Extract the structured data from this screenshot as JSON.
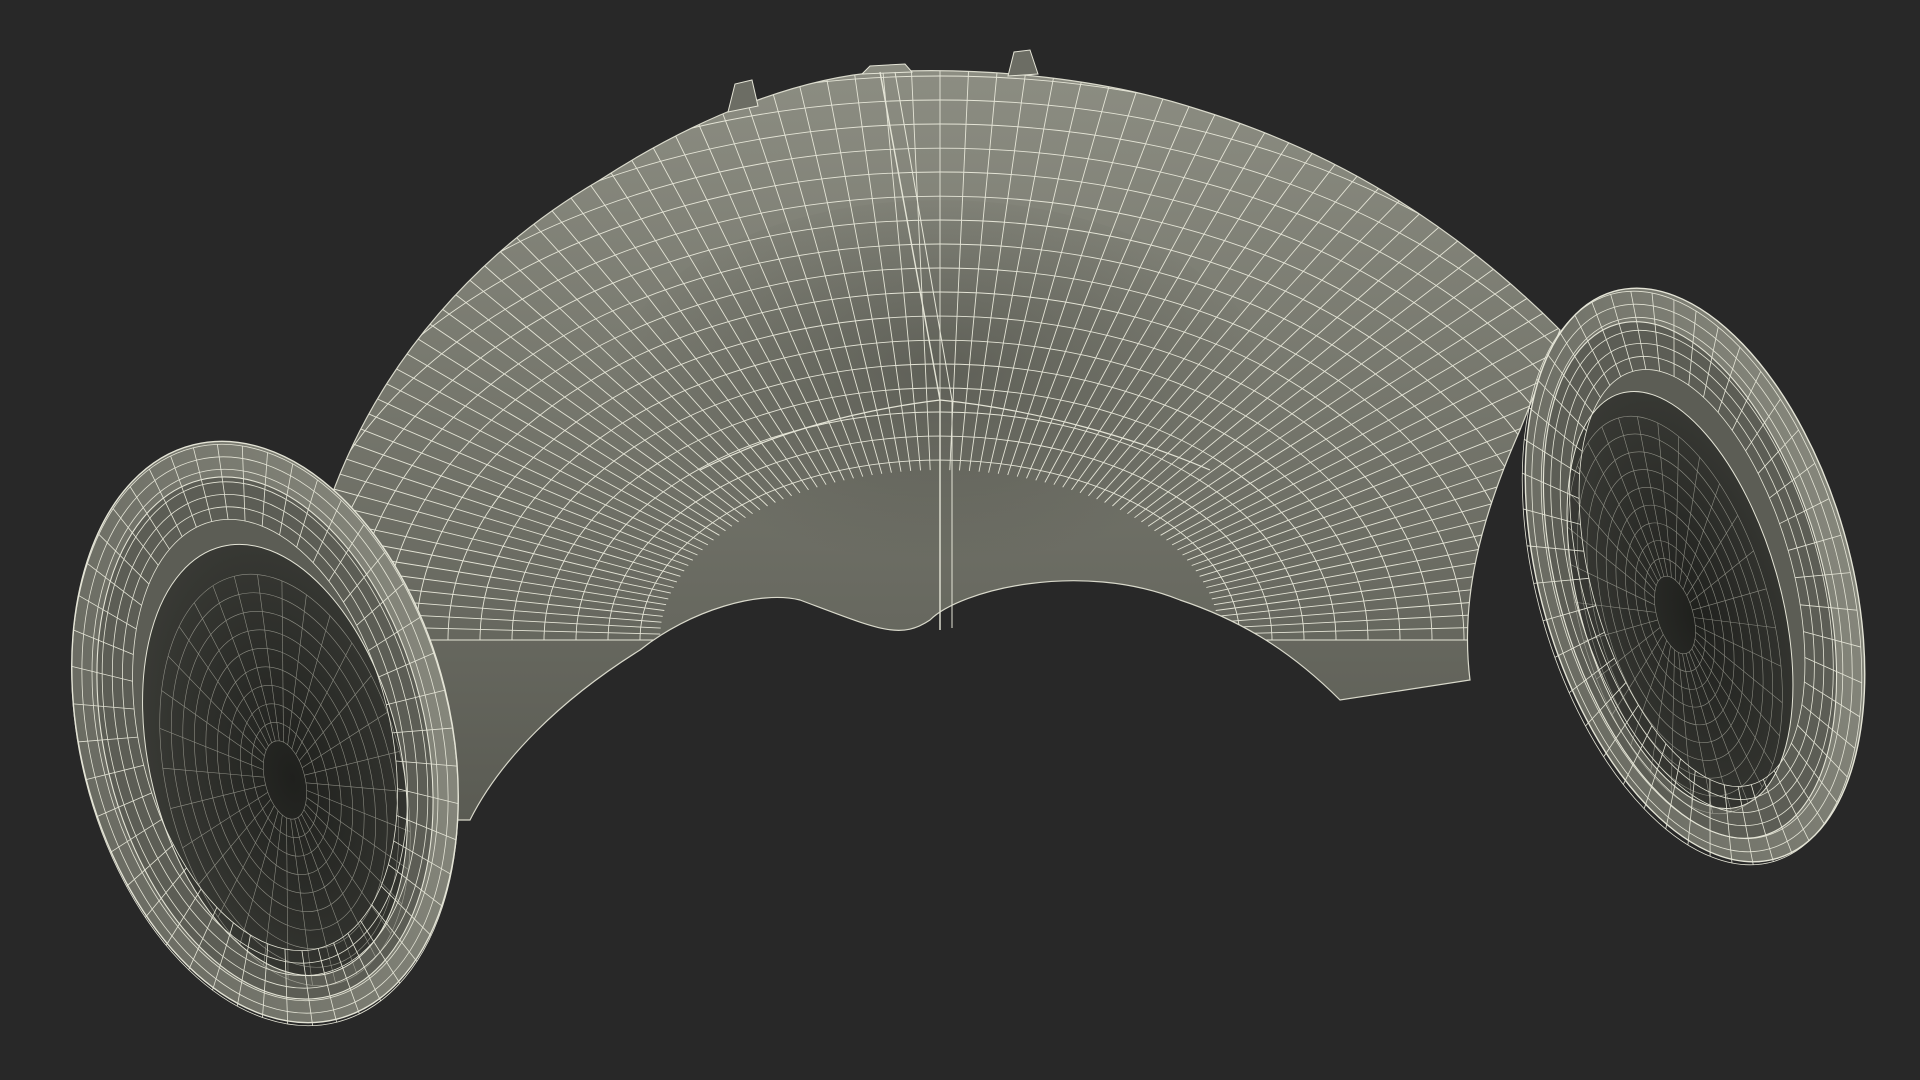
{
  "scene": {
    "subject": "wireframe-mesh-model",
    "render_mode": "wireframe-over-shaded",
    "colors": {
      "background": "#282828",
      "surface": "#6f7066",
      "surface_light": "#8a8b80",
      "surface_dark": "#4e4f47",
      "interior": "#2f302c",
      "wire": "#e4e4d6"
    },
    "icons": []
  }
}
